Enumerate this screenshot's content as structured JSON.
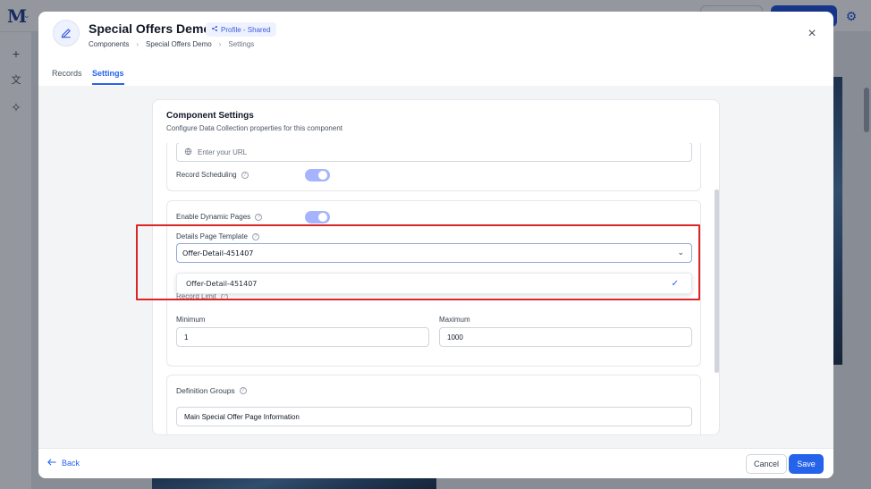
{
  "background": {
    "logo_letter": "M"
  },
  "header": {
    "title": "Special Offers Demo",
    "badge": "Profile - Shared",
    "breadcrumb": [
      "Components",
      "Special Offers Demo",
      "Settings"
    ]
  },
  "tabs": [
    {
      "label": "Records",
      "active": false
    },
    {
      "label": "Settings",
      "active": true
    }
  ],
  "card": {
    "title": "Component Settings",
    "subtitle": "Configure Data Collection properties for this component",
    "url_placeholder": "Enter your URL",
    "record_scheduling_label": "Record Scheduling",
    "record_scheduling_on": true,
    "dynamic_pages_label": "Enable Dynamic Pages",
    "dynamic_pages_on": true,
    "details_template_label": "Details Page Template",
    "details_template_value": "Offer-Detail-451407",
    "dropdown_option": "Offer-Detail-451407",
    "record_limit_label": "Record Limit",
    "minimum_label": "Minimum",
    "minimum_value": "1",
    "maximum_label": "Maximum",
    "maximum_value": "1000",
    "definition_groups_label": "Definition Groups",
    "definition_group_value": "Main Special Offer Page Information"
  },
  "footer": {
    "back_label": "Back",
    "cancel_label": "Cancel",
    "save_label": "Save"
  },
  "colors": {
    "accent": "#2563eb",
    "highlight": "#dc2626",
    "toggle_on": "#a5b4fc"
  }
}
